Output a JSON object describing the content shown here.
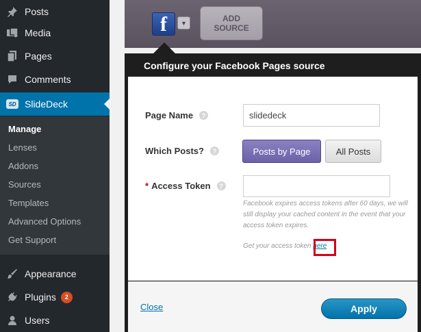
{
  "sidebar": {
    "items": [
      {
        "label": "Posts",
        "icon": "pushpin-icon"
      },
      {
        "label": "Media",
        "icon": "media-icon"
      },
      {
        "label": "Pages",
        "icon": "pages-icon"
      },
      {
        "label": "Comments",
        "icon": "comments-icon"
      },
      {
        "label": "SlideDeck",
        "icon": "slidedeck-icon",
        "logo_text": "SD"
      },
      {
        "label": "Appearance",
        "icon": "paintbrush-icon"
      },
      {
        "label": "Plugins",
        "icon": "plugin-icon",
        "badge": "2"
      },
      {
        "label": "Users",
        "icon": "users-icon"
      }
    ],
    "submenu": [
      "Manage",
      "Lenses",
      "Addons",
      "Sources",
      "Templates",
      "Advanced Options",
      "Get Support"
    ]
  },
  "toolbar": {
    "facebook_glyph": "f",
    "add_source_line1": "ADD",
    "add_source_line2": "SOURCE"
  },
  "modal": {
    "title": "Configure your Facebook Pages source",
    "page_name_label": "Page Name",
    "page_name_value": "slidedeck",
    "which_posts_label": "Which Posts?",
    "option_by_page": "Posts by Page",
    "option_all_posts": "All Posts",
    "required_mark": "*",
    "access_token_label": "Access Token",
    "access_token_value": "",
    "token_note": "Facebook expires access tokens after 60 days, we will still display your cached content in the event that your access token expires.",
    "token_link_prefix": "Get your access token",
    "token_link_text": "here",
    "help_glyph": "?",
    "close_label": "Close",
    "apply_label": "Apply"
  },
  "colors": {
    "sidebar_bg": "#23282d",
    "active_blue": "#0073aa",
    "posts_by_page_purple": "#6b62a8",
    "highlight_red": "#d0021b"
  }
}
